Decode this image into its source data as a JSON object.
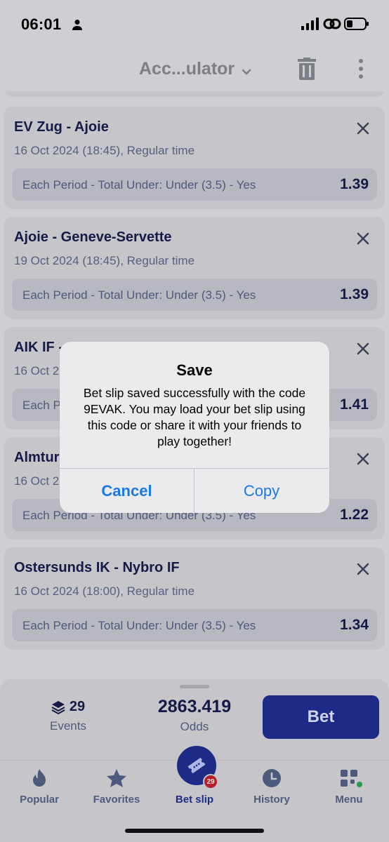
{
  "status_bar": {
    "time": "06:01"
  },
  "header": {
    "title": "Acc...ulator"
  },
  "bets": [
    {
      "match": "EV Zug - Ajoie",
      "date": "16 Oct 2024 (18:45), Regular time",
      "market": "Each Period - Total Under: Under (3.5) - Yes",
      "odds": "1.39"
    },
    {
      "match": "Ajoie - Geneve-Servette",
      "date": "19 Oct 2024 (18:45), Regular time",
      "market": "Each Period - Total Under: Under (3.5) - Yes",
      "odds": "1.39"
    },
    {
      "match": "AIK IF - ",
      "date": "16 Oct 2",
      "market": "Each P",
      "odds": "1.41"
    },
    {
      "match": "Almtur",
      "date": "16 Oct 2",
      "market": "Each Period - Total Under: Under (3.5) - Yes",
      "odds": "1.22"
    },
    {
      "match": "Ostersunds IK - Nybro IF",
      "date": "16 Oct 2024 (18:00), Regular time",
      "market": "Each Period - Total Under: Under (3.5) - Yes",
      "odds": "1.34"
    }
  ],
  "summary": {
    "events_count": "29",
    "events_label": "Events",
    "odds_value": "2863.419",
    "odds_label": "Odds",
    "bet_label": "Bet"
  },
  "tabs": [
    {
      "label": "Popular",
      "icon": "flame-icon"
    },
    {
      "label": "Favorites",
      "icon": "star-icon"
    },
    {
      "label": "Bet slip",
      "icon": "ticket-icon",
      "badge": "29"
    },
    {
      "label": "History",
      "icon": "clock-icon"
    },
    {
      "label": "Menu",
      "icon": "grid-icon"
    }
  ],
  "alert": {
    "title": "Save",
    "message": "Bet slip saved successfully with the code 9EVAK. You may load your bet slip using this code or share it with your friends to play together!",
    "cancel_label": "Cancel",
    "copy_label": "Copy"
  },
  "colors": {
    "primary": "#1d2b86",
    "alert_button": "#1a78e6",
    "badge": "#b3202a",
    "online_dot": "#2b9a4c"
  }
}
